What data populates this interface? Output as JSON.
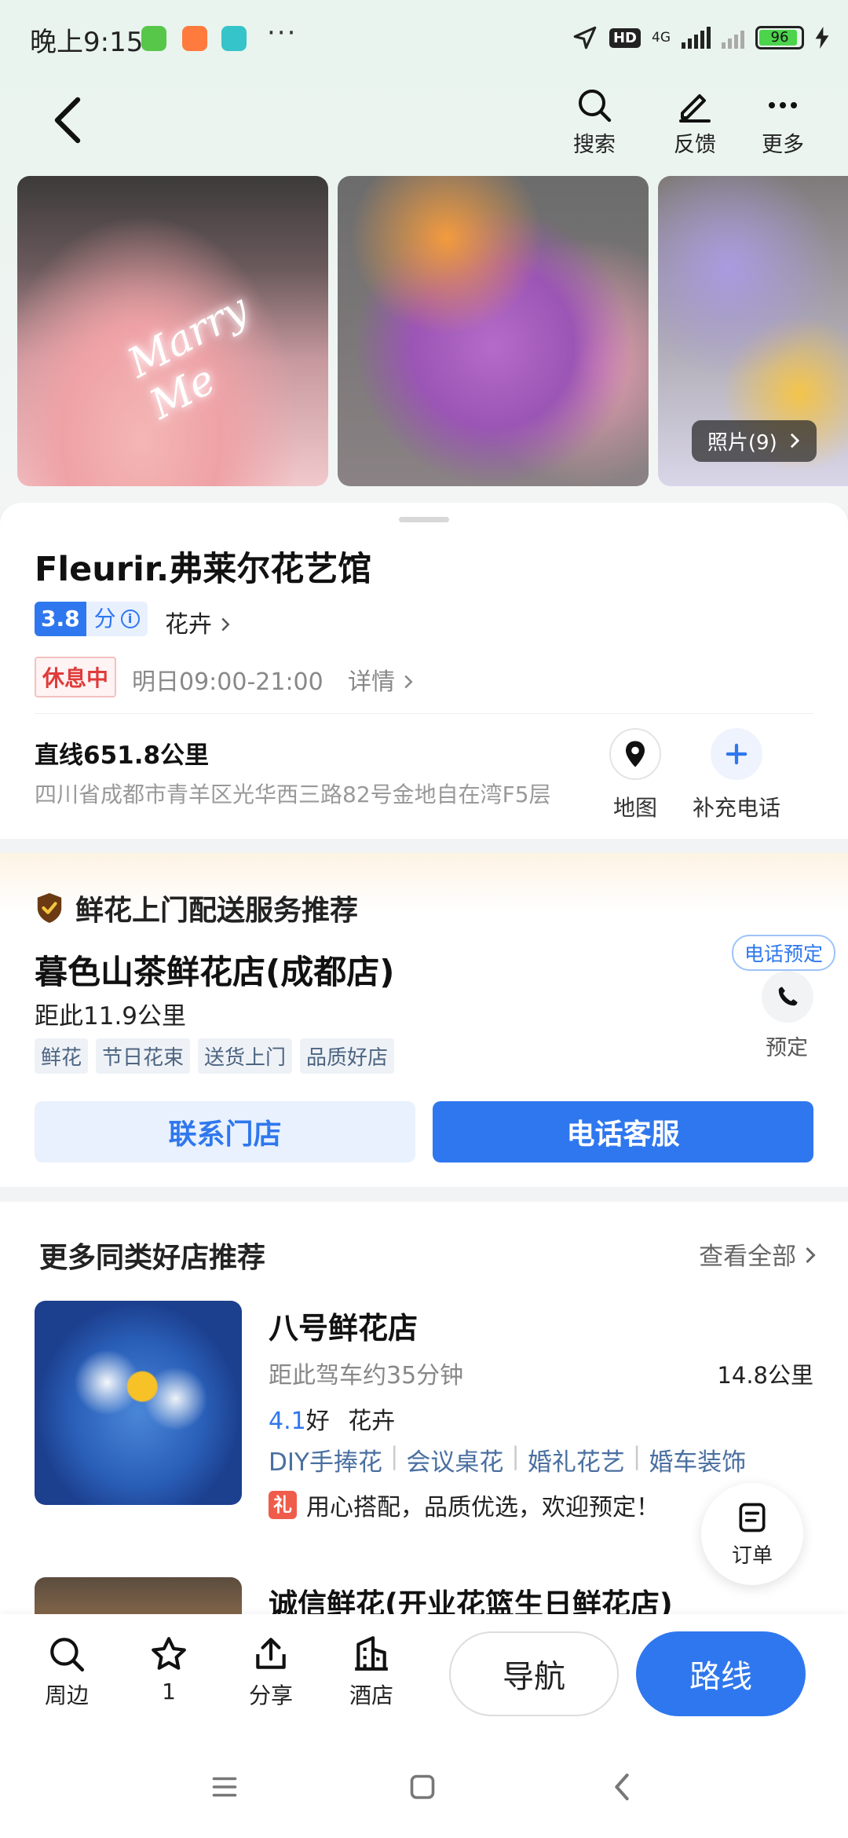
{
  "status_bar": {
    "time": "晚上9:15",
    "hd": "HD",
    "network": "4G",
    "battery": "96",
    "app_colors": [
      "#57c74a",
      "#ff7a3d",
      "#35c4c9"
    ]
  },
  "toolbar": {
    "search": "搜索",
    "feedback": "反馈",
    "more": "更多"
  },
  "photos": {
    "neon_text": "Marry Me",
    "count_label": "照片(9)"
  },
  "shop": {
    "name": "Fleurir.弗莱尔花艺馆",
    "rating": "3.8",
    "rating_unit": "分",
    "category": "花卉",
    "status": "休息中",
    "hours": "明日09:00-21:00",
    "detail": "详情",
    "distance": "直线651.8公里",
    "address": "四川省成都市青羊区光华西三路82号金地自在湾F5层",
    "map_label": "地图",
    "add_phone_label": "补充电话"
  },
  "delivery": {
    "heading": "鲜花上门配送服务推荐",
    "shop_name": "暮色山茶鲜花店(成都店)",
    "distance": "距此11.9公里",
    "tags": [
      "鲜花",
      "节日花束",
      "送货上门",
      "品质好店"
    ],
    "phone_pill": "电话预定",
    "reserve": "预定",
    "contact_button": "联系门店",
    "service_button": "电话客服"
  },
  "more_shops": {
    "title": "更多同类好店推荐",
    "view_all": "查看全部",
    "shop1": {
      "name": "八号鲜花店",
      "drive": "距此驾车约35分钟",
      "km": "14.8公里",
      "rating": "4.1",
      "rating_word": "好",
      "category": "花卉",
      "tags": [
        "DIY手捧花",
        "会议桌花",
        "婚礼花艺",
        "婚车装饰"
      ],
      "gift_icon_text": "礼",
      "promo": "用心搭配，品质优选，欢迎预定！"
    },
    "shop2": {
      "name": "诚信鲜花(开业花篮生日鲜花店)"
    }
  },
  "order_fab": "订单",
  "action_bar": {
    "nearby": "周边",
    "favorites": "1",
    "share": "分享",
    "hotel": "酒店",
    "navigate": "导航",
    "route": "路线"
  },
  "accent_color": "#2f77ee"
}
